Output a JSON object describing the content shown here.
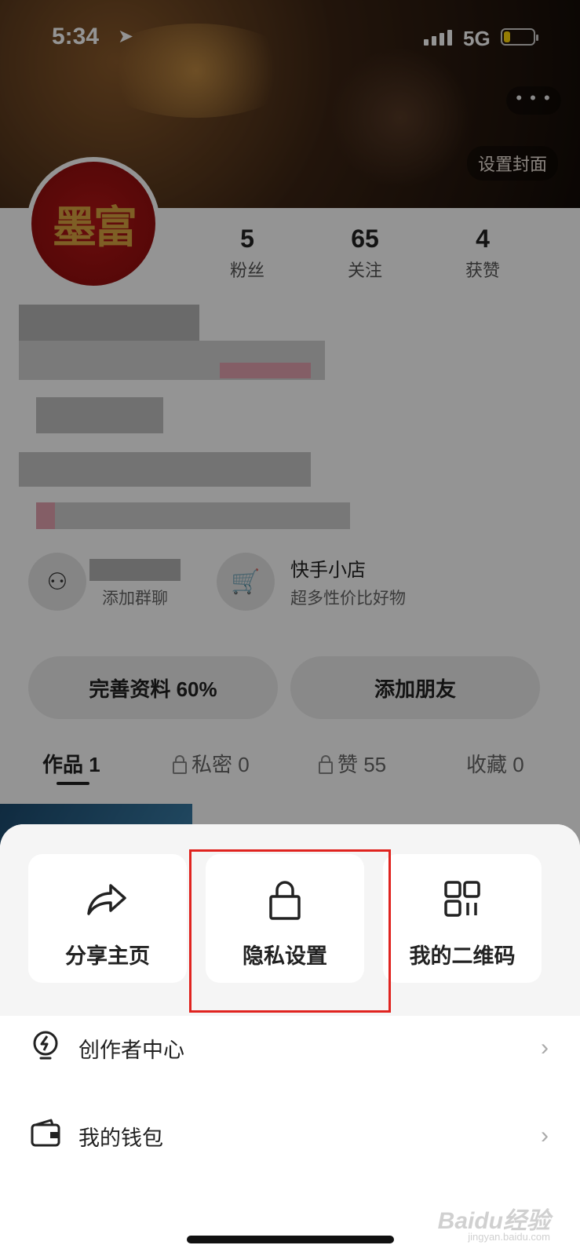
{
  "status_bar": {
    "time": "5:34",
    "network": "5G"
  },
  "cover": {
    "more_label": "• • •",
    "set_cover_label": "设置封面"
  },
  "avatar_text": "墨富",
  "stats": [
    {
      "value": "5",
      "label": "粉丝"
    },
    {
      "value": "65",
      "label": "关注"
    },
    {
      "value": "4",
      "label": "获赞"
    }
  ],
  "features": [
    {
      "title": "",
      "subtitle": "添加群聊",
      "icon": "group-icon"
    },
    {
      "title": "快手小店",
      "subtitle": "超多性价比好物",
      "icon": "cart-icon"
    }
  ],
  "buttons": {
    "complete_profile": "完善资料 60%",
    "add_friend": "添加朋友"
  },
  "tabs": [
    {
      "label": "作品 1",
      "locked": false
    },
    {
      "label": "私密 0",
      "locked": true
    },
    {
      "label": "赞 55",
      "locked": true
    },
    {
      "label": "收藏 0",
      "locked": false
    }
  ],
  "sheet": {
    "cards": [
      {
        "label": "分享主页",
        "icon": "share-icon"
      },
      {
        "label": "隐私设置",
        "icon": "lock-icon"
      },
      {
        "label": "我的二维码",
        "icon": "qr-code-icon"
      }
    ],
    "rows": [
      {
        "label": "创作者中心",
        "icon": "creator-bulb-icon"
      },
      {
        "label": "我的钱包",
        "icon": "wallet-icon"
      }
    ],
    "chevron": "›"
  },
  "watermark": {
    "brand": "Baidu经验",
    "url": "jingyan.baidu.com"
  },
  "colors": {
    "highlight": "#e0231f",
    "battery": "#ffd60a",
    "avatar_bg": "#a81212"
  }
}
